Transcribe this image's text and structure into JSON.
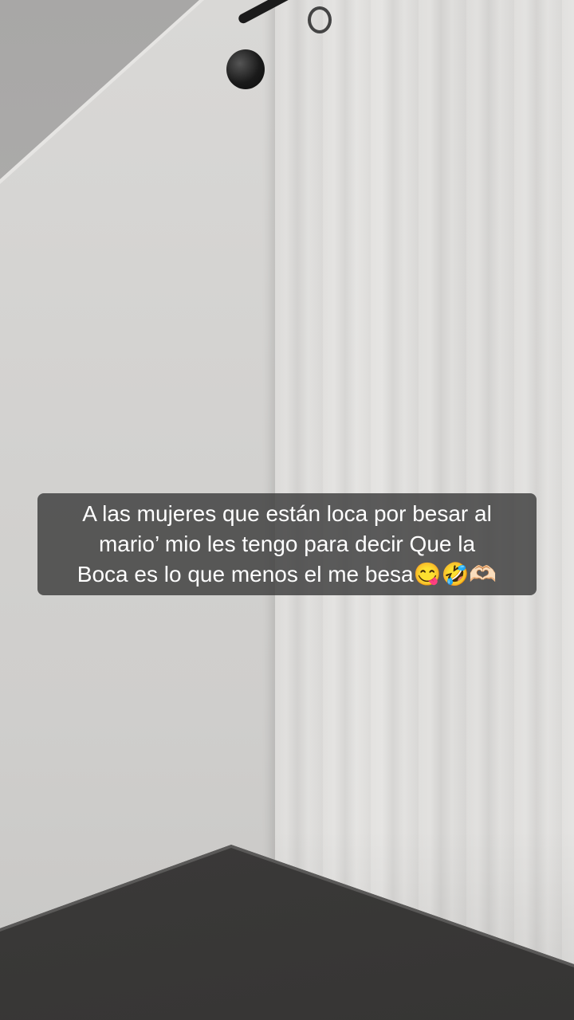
{
  "caption": {
    "lines": [
      "A las mujeres que están loca por besar al",
      "mario’ mio les tengo para decir Que la",
      "Boca es lo que menos el me besa😋🤣🫶🏻"
    ]
  },
  "scene": {
    "objects": [
      "white-wall",
      "sloped-ceiling",
      "white-curtain",
      "black-curtain-rod",
      "dark-wood-table"
    ]
  },
  "colors": {
    "caption_bg": "#3c3c3c",
    "caption_text": "#ffffff",
    "curtain": "#e0dfdd",
    "wall": "#d3d2d0",
    "table": "#3f3e3d"
  }
}
